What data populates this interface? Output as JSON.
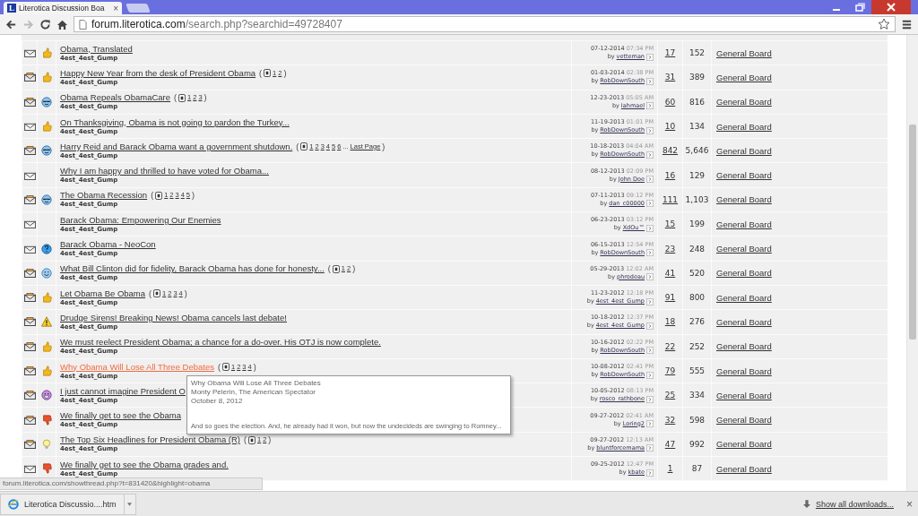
{
  "browser": {
    "tab": {
      "favicon": "L",
      "title": "Literotica Discussion Boa",
      "close": "×"
    },
    "nav": {
      "forward_disabled": true
    },
    "address": {
      "host": "forum.literotica.com",
      "path": "/search.php?searchid=49728407"
    }
  },
  "threads": [
    {
      "hot": false,
      "kind": "thumbs-up",
      "title": "Obama, Translated",
      "hovered": false,
      "author": "4est_4est_Gump",
      "date": "07-12-2014",
      "time": "07:34 PM",
      "by": "by",
      "last_poster": "vetteman",
      "replies": "17",
      "views": "152",
      "forum": "General Board"
    },
    {
      "hot": true,
      "kind": "thumbs-up",
      "title": "Happy New Year from the desk of President Obama",
      "hovered": false,
      "pages": {
        "open": "(",
        "links": [
          "1",
          "2"
        ],
        "close": ")"
      },
      "author": "4est_4est_Gump",
      "date": "01-03-2014",
      "time": "02:38 PM",
      "by": "by",
      "last_poster": "RobDownSouth",
      "replies": "31",
      "views": "389",
      "forum": "General Board"
    },
    {
      "hot": true,
      "kind": "cool",
      "title": "Obama Repeals ObamaCare",
      "hovered": false,
      "pages": {
        "open": "(",
        "links": [
          "1",
          "2",
          "3"
        ],
        "close": ")"
      },
      "author": "4est_4est_Gump",
      "date": "12-23-2013",
      "time": "05:05 AM",
      "by": "by",
      "last_poster": "Iahmael",
      "replies": "60",
      "views": "816",
      "forum": "General Board"
    },
    {
      "hot": false,
      "kind": "thumbs-up",
      "title": "On Thanksgiving, Obama is not going to pardon the Turkey...",
      "hovered": false,
      "author": "4est_4est_Gump",
      "date": "11-19-2013",
      "time": "01:01 PM",
      "by": "by",
      "last_poster": "RobDownSouth",
      "replies": "10",
      "views": "134",
      "forum": "General Board"
    },
    {
      "hot": true,
      "kind": "cool",
      "title": "Harry Reid and Barack Obama want a government shutdown.",
      "hovered": false,
      "pages": {
        "open": "(",
        "links": [
          "1",
          "2",
          "3",
          "4",
          "5",
          "6"
        ],
        "gap": "...",
        "last": "Last Page",
        "close": ")"
      },
      "author": "4est_4est_Gump",
      "date": "10-18-2013",
      "time": "04:04 AM",
      "by": "by",
      "last_poster": "RobDownSouth",
      "replies": "842",
      "views": "5,646",
      "forum": "General Board"
    },
    {
      "hot": false,
      "title": "Why I am happy and thrilled to have voted for Obama...",
      "hovered": false,
      "author": "4est_4est_Gump",
      "date": "08-12-2013",
      "time": "02:09 PM",
      "by": "by",
      "last_poster": "John Doe",
      "replies": "16",
      "views": "129",
      "forum": "General Board"
    },
    {
      "hot": true,
      "kind": "cool",
      "title": "The Obama Recession",
      "hovered": false,
      "pages": {
        "open": "(",
        "links": [
          "1",
          "2",
          "3",
          "4",
          "5"
        ],
        "close": ")"
      },
      "author": "4est_4est_Gump",
      "date": "07-11-2013",
      "time": "09:12 PM",
      "by": "by",
      "last_poster": "dan_c00000",
      "replies": "111",
      "views": "1,103",
      "forum": "General Board"
    },
    {
      "hot": false,
      "title": "Barack Obama: Empowering Our Enemies",
      "hovered": false,
      "author": "4est_4est_Gump",
      "date": "06-23-2013",
      "time": "03:12 PM",
      "by": "by",
      "last_poster": "XdOu™",
      "replies": "15",
      "views": "199",
      "forum": "General Board"
    },
    {
      "hot": false,
      "kind": "question",
      "title": "Barack Obama - NeoCon",
      "hovered": false,
      "author": "4est_4est_Gump",
      "date": "06-15-2013",
      "time": "12:54 PM",
      "by": "by",
      "last_poster": "RobDownSouth",
      "replies": "23",
      "views": "248",
      "forum": "General Board"
    },
    {
      "hot": true,
      "kind": "smile",
      "title": "What Bill Clinton did for fidelity, Barack Obama has done for honesty...",
      "hovered": false,
      "pages": {
        "open": "(",
        "links": [
          "1",
          "2"
        ],
        "close": ")"
      },
      "author": "4est_4est_Gump",
      "date": "05-29-2013",
      "time": "12:02 AM",
      "by": "by",
      "last_poster": "phrodeau",
      "replies": "41",
      "views": "520",
      "forum": "General Board"
    },
    {
      "hot": true,
      "kind": "thumbs-up",
      "title": "Let Obama Be Obama",
      "hovered": false,
      "pages": {
        "open": "(",
        "links": [
          "1",
          "2",
          "3",
          "4"
        ],
        "close": ")"
      },
      "author": "4est_4est_Gump",
      "date": "11-23-2012",
      "time": "12:18 PM",
      "by": "by",
      "last_poster": "4est_4est_Gump",
      "replies": "91",
      "views": "800",
      "forum": "General Board"
    },
    {
      "hot": true,
      "kind": "warning",
      "title": "Drudge Sirens! Breaking News! Obama cancels last debate!",
      "hovered": false,
      "author": "4est_4est_Gump",
      "date": "10-18-2012",
      "time": "12:37 PM",
      "by": "by",
      "last_poster": "4est_4est_Gump",
      "replies": "18",
      "views": "276",
      "forum": "General Board"
    },
    {
      "hot": true,
      "kind": "thumbs-up",
      "title": "We must reelect President Obama; a chance for a do-over. His OTJ is now complete.",
      "hovered": false,
      "author": "4est_4est_Gump",
      "date": "10-16-2012",
      "time": "02:22 PM",
      "by": "by",
      "last_poster": "RobDownSouth",
      "replies": "22",
      "views": "252",
      "forum": "General Board"
    },
    {
      "hot": true,
      "kind": "thumbs-up",
      "title": "Why Obama Will Lose All Three Debates",
      "hovered": true,
      "pages": {
        "open": "(",
        "links": [
          "1",
          "2",
          "3",
          "4"
        ],
        "close": ")"
      },
      "author": "4est_4est_Gump",
      "date": "10-08-2012",
      "time": "02:41 PM",
      "by": "by",
      "last_poster": "RobDownSouth",
      "replies": "79",
      "views": "555",
      "forum": "General Board"
    },
    {
      "hot": true,
      "kind": "grin",
      "title": "I just cannot imagine President O",
      "hovered": false,
      "author": "4est_4est_Gump",
      "date": "10-05-2012",
      "time": "08:13 PM",
      "by": "by",
      "last_poster": "rosco_rathbone",
      "replies": "25",
      "views": "334",
      "forum": "General Board"
    },
    {
      "hot": true,
      "kind": "thumbs-down",
      "title": "We finally get to see the Obama",
      "hovered": false,
      "author": "4est_4est_Gump",
      "date": "09-27-2012",
      "time": "02:41 AM",
      "by": "by",
      "last_poster": "Loring2",
      "replies": "32",
      "views": "598",
      "forum": "General Board"
    },
    {
      "hot": true,
      "kind": "bulb",
      "title": "The Top Six Headlines for President Obama (R)",
      "hovered": false,
      "pages": {
        "open": "(",
        "links": [
          "1",
          "2"
        ],
        "close": ")"
      },
      "author": "4est_4est_Gump",
      "date": "09-27-2012",
      "time": "12:13 AM",
      "by": "by",
      "last_poster": "bluntforcemama",
      "replies": "47",
      "views": "992",
      "forum": "General Board"
    },
    {
      "hot": false,
      "kind": "thumbs-down",
      "title": "We finally get to see the Obama grades and.",
      "hovered": false,
      "author": "4est_4est_Gump",
      "date": "09-25-2012",
      "time": "12:47 PM",
      "by": "by",
      "last_poster": "kbate",
      "replies": "1",
      "views": "87",
      "forum": "General Board"
    }
  ],
  "tooltip": {
    "title": "Why Obama Will Lose All Three Debates",
    "source": "Monty Pelerin, The American Spectator",
    "date": "October 8, 2012",
    "snippet": "And so goes the election. And, he already had it won, but now the undecideds are swinging to Romney..."
  },
  "status_url": "forum.literotica.com/showthread.php?t=831420&highlight=obama",
  "downloads": {
    "item": "Literotica Discussio....htm",
    "show_all": "Show all downloads...",
    "close": "×"
  }
}
